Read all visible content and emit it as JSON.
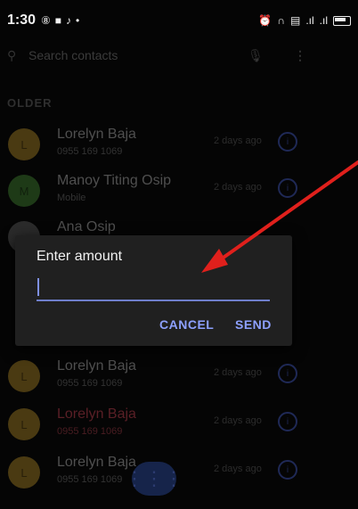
{
  "status_bar": {
    "time": "1:30"
  },
  "search": {
    "placeholder": "Search contacts"
  },
  "section": {
    "header": "OLDER"
  },
  "contacts": [
    {
      "name": "Lorelyn Baja",
      "number": "0955 169 1069",
      "date": "2 days ago",
      "avatar_letter": "L",
      "avatar_color": "#4a3a12"
    },
    {
      "name": "Manoy Titing Osip",
      "number": "Mobile",
      "date": "2 days ago",
      "avatar_letter": "M",
      "avatar_color": "#1e3a17"
    },
    {
      "name": "Ana Osip",
      "number": "",
      "date": "",
      "avatar_letter": "",
      "avatar_color": "#2b2b2b"
    },
    {
      "name": "Lorelyn Baja",
      "number": "0955 169 1069",
      "date": "2 days ago",
      "avatar_letter": "L",
      "avatar_color": "#4a3a12"
    },
    {
      "name": "Lorelyn Baja",
      "number": "0955 169 1069",
      "date": "2 days ago",
      "avatar_letter": "L",
      "avatar_color": "#4a3a12"
    },
    {
      "name": "Lorelyn Baja",
      "number": "0955 169 1069",
      "date": "2 days ago",
      "avatar_letter": "L",
      "avatar_color": "#4a3a12"
    }
  ],
  "dialog": {
    "title": "Enter amount",
    "input_value": "",
    "cancel_label": "CANCEL",
    "send_label": "SEND"
  },
  "colors": {
    "accent": "#8da0ff",
    "annotation_arrow": "#e0201c"
  }
}
